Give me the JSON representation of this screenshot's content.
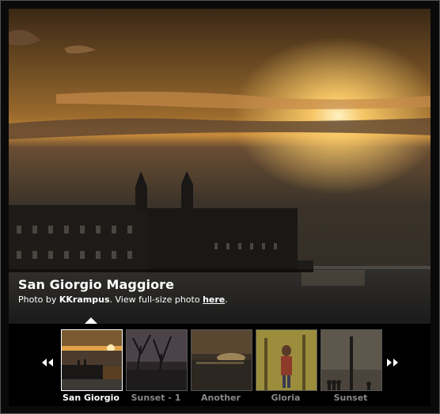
{
  "photo": {
    "title": "San Giorgio Maggiore",
    "credit_prefix": "Photo by ",
    "author": "KKrampus",
    "credit_middle": ". View full-size photo ",
    "link_text": "here",
    "credit_suffix": "."
  },
  "navigation": {
    "prev_icon": "double-chevron-left-icon",
    "next_icon": "double-chevron-right-icon"
  },
  "thumbnails": [
    {
      "label": "San Giorgio",
      "active": true
    },
    {
      "label": "Sunset - 1",
      "active": false
    },
    {
      "label": "Another",
      "active": false
    },
    {
      "label": "Gloria",
      "active": false
    },
    {
      "label": "Sunset",
      "active": false
    }
  ],
  "colors": {
    "sky_top": "#2b1d12",
    "sun": "#ffd27a",
    "water": "#3a3a3a",
    "frame": "#0a0a0a"
  }
}
